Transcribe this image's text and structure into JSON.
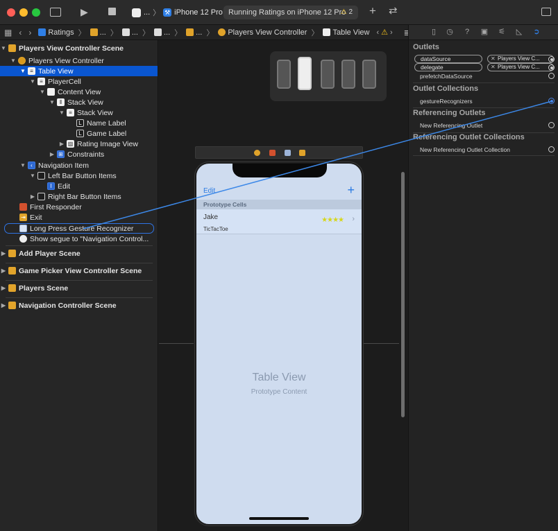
{
  "toolbar": {
    "scheme_name": "...",
    "device": "iPhone 12 Pro",
    "status": "Running Ratings on iPhone 12 Pro",
    "warning_count": "2",
    "colors": {
      "close": "#ff5f57",
      "minimize": "#febc2e",
      "zoom": "#28c840"
    }
  },
  "jumpbar": {
    "project": "Ratings",
    "group1": "...",
    "group2": "...",
    "group3": "...",
    "controller": "Players View Controller",
    "item": "Table View"
  },
  "outline": {
    "scene_title": "Players View Controller Scene",
    "controller": "Players View Controller",
    "table_view": "Table View",
    "player_cell": "PlayerCell",
    "content_view": "Content View",
    "stack_view_1": "Stack View",
    "stack_view_2": "Stack View",
    "name_label": "Name Label",
    "game_label": "Game Label",
    "rating_image_view": "Rating Image View",
    "constraints": "Constraints",
    "navigation_item": "Navigation Item",
    "left_bar_items": "Left Bar Button Items",
    "edit": "Edit",
    "right_bar_items": "Right Bar Button Items",
    "first_responder": "First Responder",
    "exit": "Exit",
    "long_press": "Long Press Gesture Recognizer",
    "segue": "Show segue to \"Navigation Control...",
    "scenes": [
      "Add Player Scene",
      "Game Picker View Controller Scene",
      "Players Scene",
      "Navigation Controller Scene"
    ]
  },
  "canvas": {
    "edit_label": "Edit",
    "plus_label": "+",
    "prototype_header": "Prototype Cells",
    "cell_name": "Jake",
    "cell_game": "TicTacToe",
    "cell_stars": "★★★★",
    "chevron": "›",
    "table_view_title": "Table View",
    "table_view_subtitle": "Prototype Content"
  },
  "inspector": {
    "outlets_header": "Outlets",
    "outlets": [
      {
        "name": "dataSource",
        "target": "Players View C..."
      },
      {
        "name": "delegate",
        "target": "Players View C..."
      },
      {
        "name": "prefetchDataSource",
        "target": ""
      }
    ],
    "outlet_collections_header": "Outlet Collections",
    "gesture_recognizers": "gestureRecognizers",
    "referencing_outlets_header": "Referencing Outlets",
    "new_ref_outlet": "New Referencing Outlet",
    "referencing_collections_header": "Referencing Outlet Collections",
    "new_ref_collection": "New Referencing Outlet Collection"
  },
  "accent": "#0a56d0",
  "connection_color": "#3c88e8"
}
